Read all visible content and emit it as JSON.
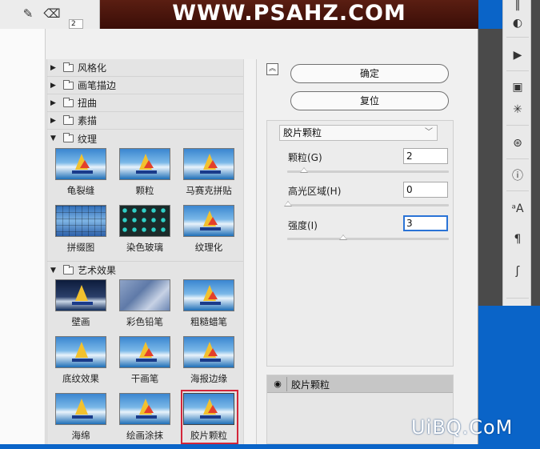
{
  "banner": {
    "text": "WWW.PSAHZ.COM"
  },
  "top_tools": {
    "size_value": "2"
  },
  "categories": [
    {
      "label": "风格化",
      "expanded": false
    },
    {
      "label": "画笔描边",
      "expanded": false
    },
    {
      "label": "扭曲",
      "expanded": false
    },
    {
      "label": "素描",
      "expanded": false
    },
    {
      "label": "纹理",
      "expanded": true
    },
    {
      "label": "艺术效果",
      "expanded": true
    }
  ],
  "texture_filters": [
    "龟裂缝",
    "颗粒",
    "马赛克拼贴",
    "拼缀图",
    "染色玻璃",
    "纹理化"
  ],
  "artistic_filters": [
    "壁画",
    "彩色铅笔",
    "粗糙蜡笔",
    "底纹效果",
    "干画笔",
    "海报边缘",
    "海绵",
    "绘画涂抹",
    "胶片颗粒"
  ],
  "selected_filter": "胶片颗粒",
  "buttons": {
    "ok": "确定",
    "reset": "复位"
  },
  "settings": {
    "filter_select": "胶片颗粒",
    "params": [
      {
        "label": "颗粒(G)",
        "value": "2",
        "slider": 0.1
      },
      {
        "label": "高光区域(H)",
        "value": "0",
        "slider": 0.0
      },
      {
        "label": "强度(I)",
        "value": "3",
        "slider": 0.35
      }
    ]
  },
  "layers": {
    "item_name": "胶片颗粒"
  },
  "watermark": {
    "text": "UiBQ.CoM"
  },
  "colors": {
    "selection_border": "#d3263a",
    "accent_blue": "#2a73d6",
    "desktop_blue": "#0a64c8"
  }
}
